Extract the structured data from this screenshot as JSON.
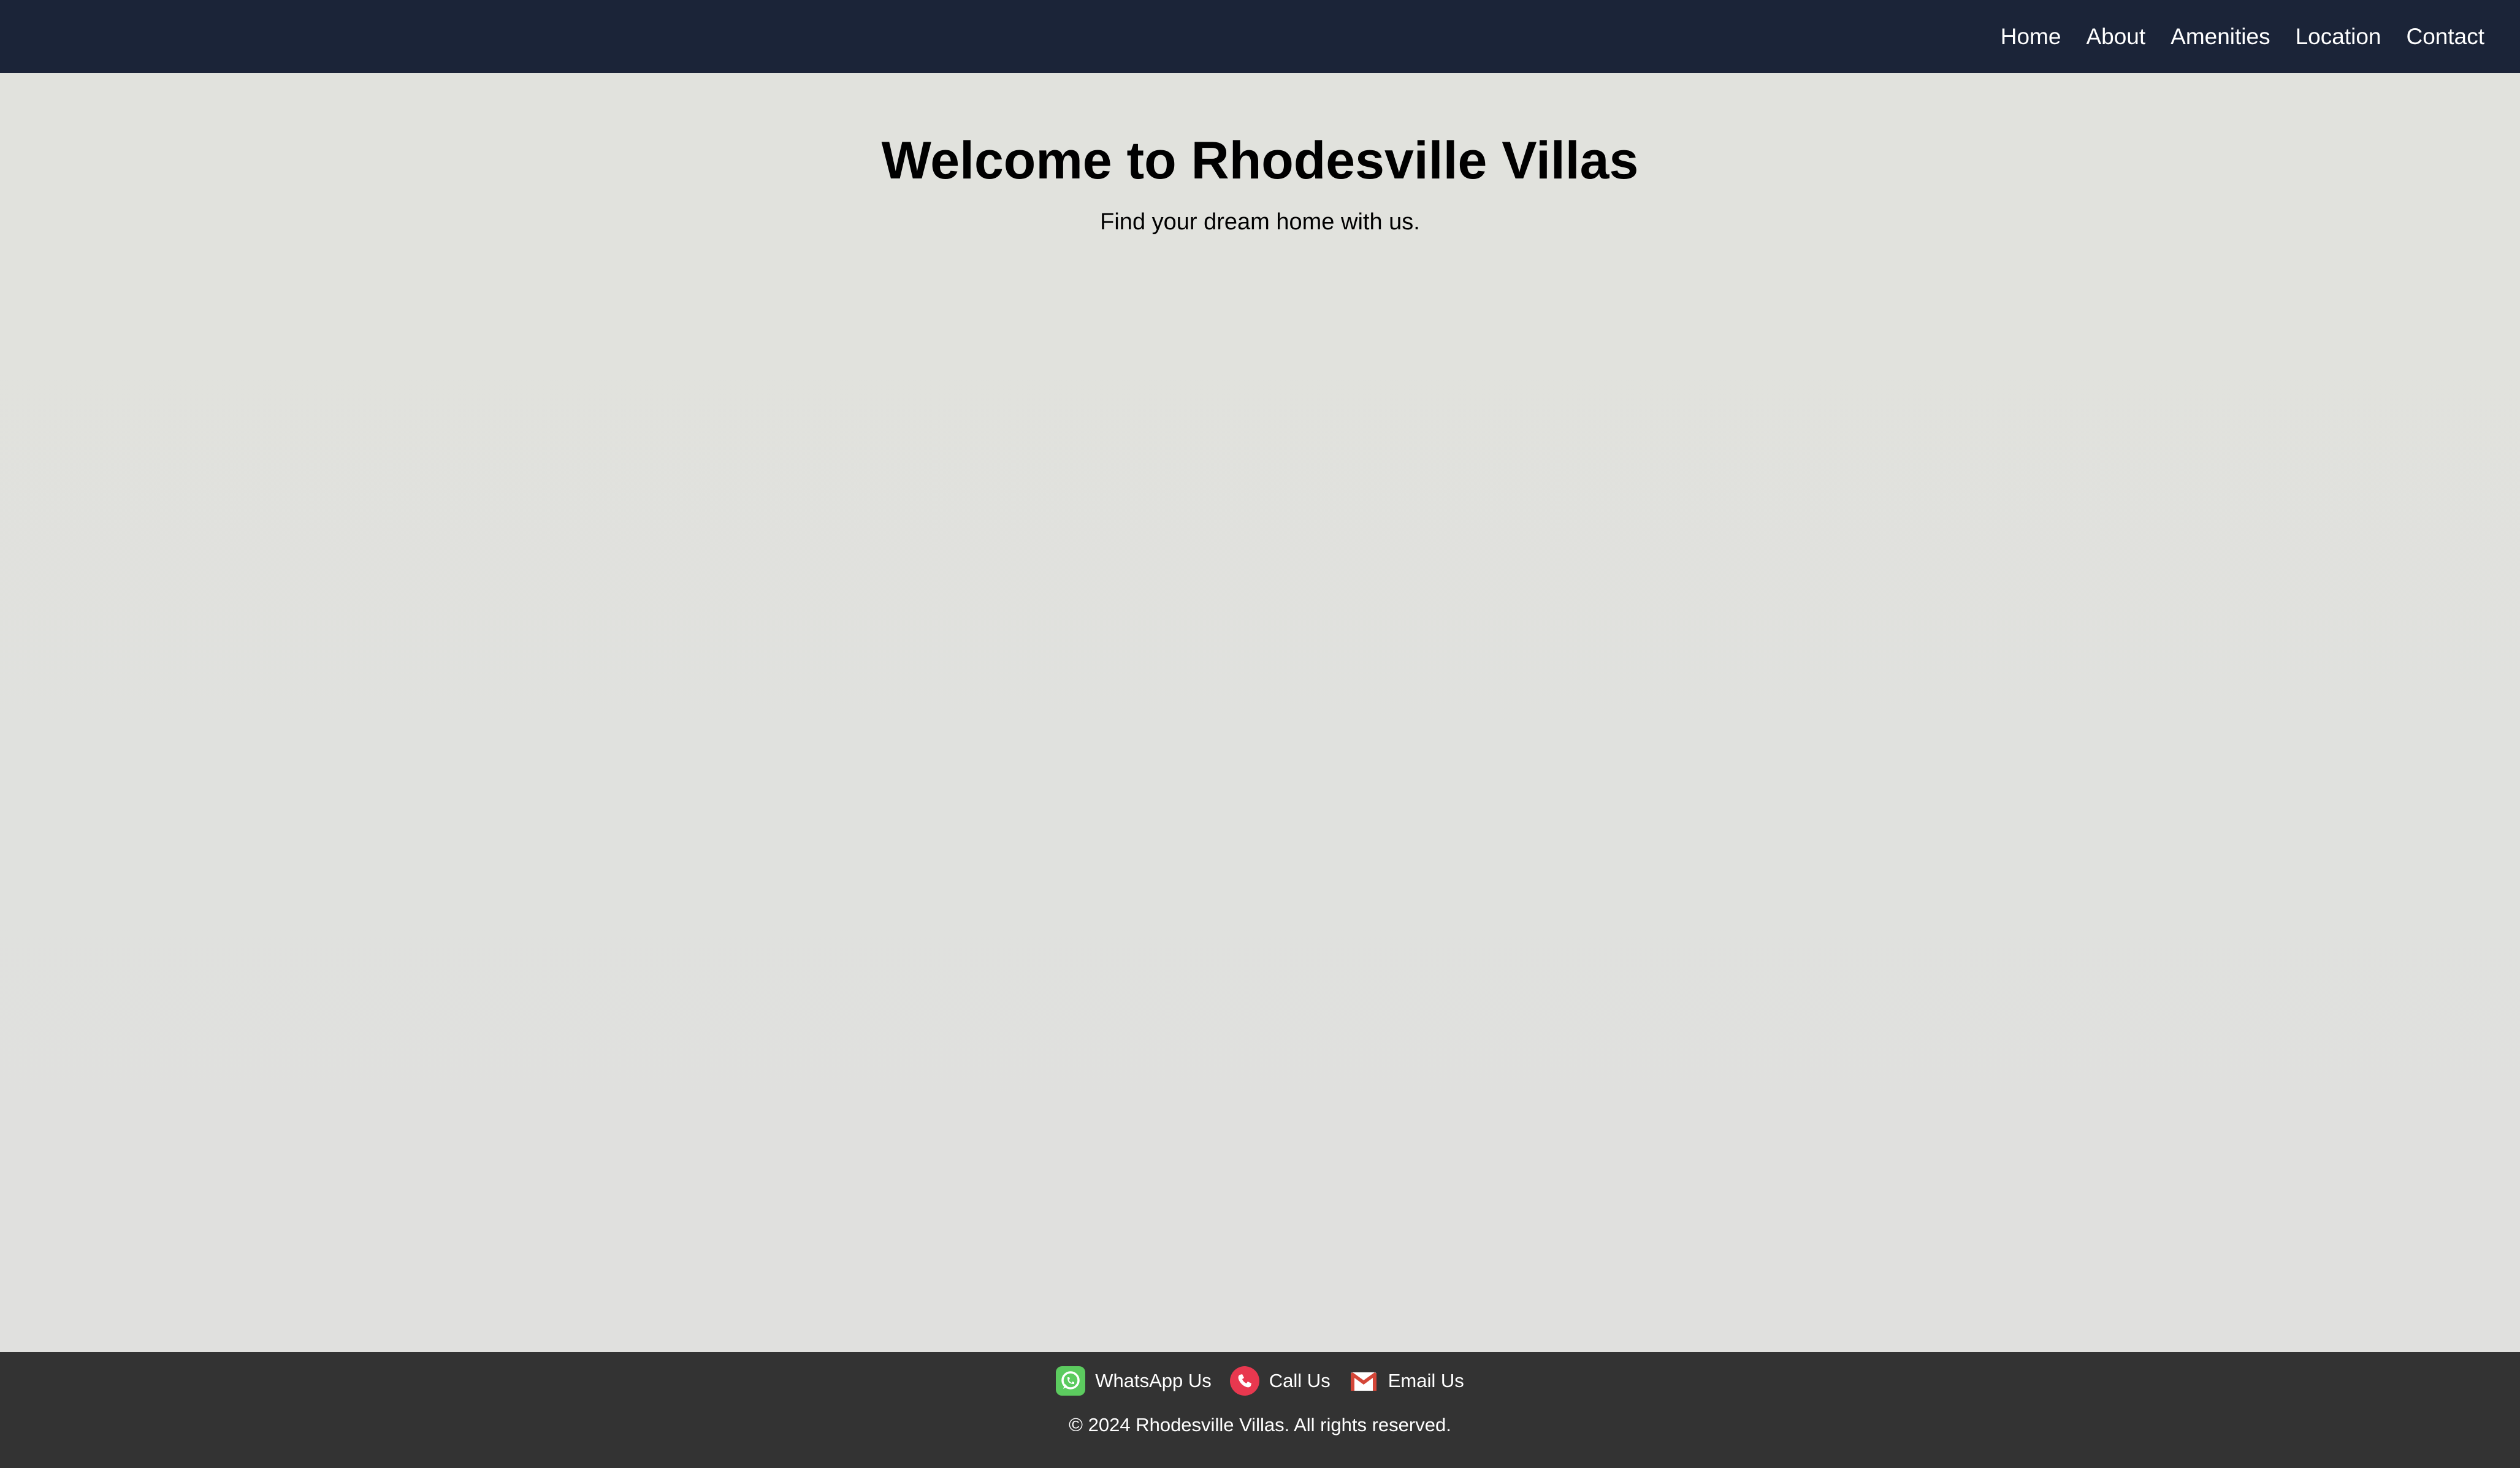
{
  "nav": {
    "items": [
      {
        "label": "Home"
      },
      {
        "label": "About"
      },
      {
        "label": "Amenities"
      },
      {
        "label": "Location"
      },
      {
        "label": "Contact"
      }
    ]
  },
  "hero": {
    "title": "Welcome to Rhodesville Villas",
    "subtitle": "Find your dream home with us."
  },
  "footer": {
    "contacts": [
      {
        "label": "WhatsApp Us",
        "icon": "whatsapp-icon",
        "color": "#5ccb5f"
      },
      {
        "label": "Call Us",
        "icon": "phone-icon",
        "color": "#e8384f"
      },
      {
        "label": "Email Us",
        "icon": "email-icon",
        "color": "#d44638"
      }
    ],
    "copyright": "© 2024 Rhodesville Villas. All rights reserved."
  },
  "colors": {
    "nav_background": "#1b2438",
    "page_background": "#e0e0de",
    "footer_background": "#333333"
  }
}
